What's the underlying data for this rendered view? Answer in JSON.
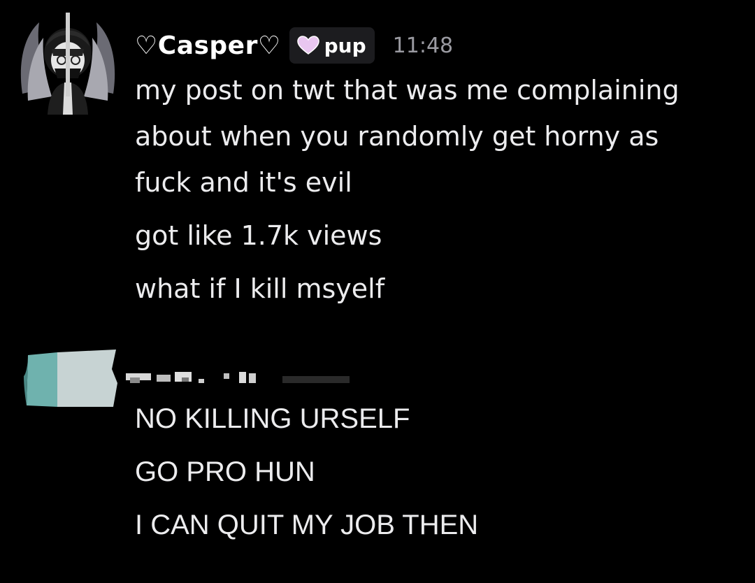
{
  "messages": [
    {
      "author": "♡Casper♡",
      "role_tag": {
        "icon": "pink-heart-icon",
        "icon_color": "#e9c6f0",
        "label": "pup"
      },
      "timestamp": "11:48",
      "lines": [
        "my post on twt that was me complaining",
        "about when you randomly get horny as",
        "fuck and it's evil",
        "got like 1.7k views",
        "what if I kill msyelf"
      ]
    },
    {
      "author_redacted": true,
      "lines": [
        "NO KILLING URSELF",
        "GO PRO HUN",
        "I CAN QUIT MY JOB THEN"
      ]
    }
  ],
  "colors": {
    "background": "#000000",
    "text": "#ececee",
    "timestamp": "#9a9aa1",
    "role_tag_bg": "#1c1c1f",
    "redacted_teal": "#6fb2ae",
    "redacted_light": "#c7d3d3"
  }
}
